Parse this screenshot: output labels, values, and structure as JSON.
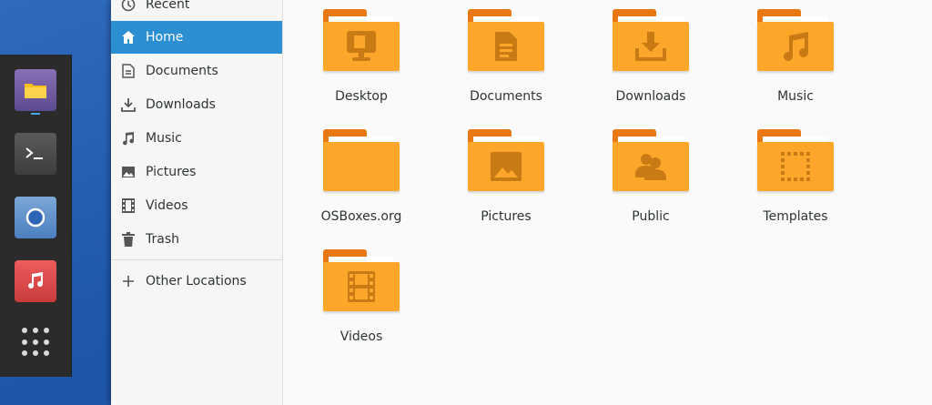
{
  "sidebar": {
    "items": [
      {
        "label": "Recent",
        "icon": "clock-icon"
      },
      {
        "label": "Home",
        "icon": "home-icon",
        "active": true
      },
      {
        "label": "Documents",
        "icon": "document-icon"
      },
      {
        "label": "Downloads",
        "icon": "download-icon"
      },
      {
        "label": "Music",
        "icon": "music-note-icon"
      },
      {
        "label": "Pictures",
        "icon": "image-icon"
      },
      {
        "label": "Videos",
        "icon": "film-icon"
      },
      {
        "label": "Trash",
        "icon": "trash-icon"
      }
    ],
    "other_locations": {
      "label": "Other Locations",
      "icon": "plus-icon"
    }
  },
  "folders": [
    {
      "label": "Desktop",
      "emblem": "desktop-icon"
    },
    {
      "label": "Documents",
      "emblem": "document-icon"
    },
    {
      "label": "Downloads",
      "emblem": "download-icon"
    },
    {
      "label": "Music",
      "emblem": "music-note-icon"
    },
    {
      "label": "OSBoxes.org",
      "emblem": "none"
    },
    {
      "label": "Pictures",
      "emblem": "image-icon"
    },
    {
      "label": "Public",
      "emblem": "users-icon"
    },
    {
      "label": "Templates",
      "emblem": "template-icon"
    },
    {
      "label": "Videos",
      "emblem": "film-icon"
    }
  ],
  "dock": {
    "apps": [
      "files-app-icon",
      "terminal-app-icon",
      "browser-app-icon",
      "music-app-icon"
    ],
    "show_apps": "app-grid-icon"
  },
  "colors": {
    "accent": "#2b8fd1",
    "folder_body": "#fda72a",
    "folder_tab": "#e8780f",
    "desktop_bg": "#1f58ac"
  }
}
